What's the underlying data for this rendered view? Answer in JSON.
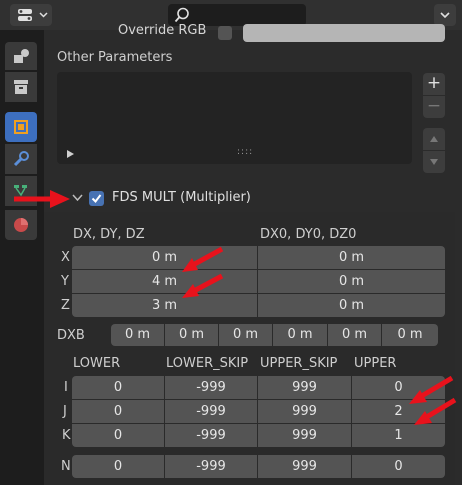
{
  "header": {
    "search_icon": "search-icon",
    "dropdown_icon": "chevron-down-icon"
  },
  "sidebar": {
    "tabs": [
      "tool-tab",
      "render-tab",
      "output-tab",
      "modifier-tab",
      "particles-tab",
      "material-tab"
    ]
  },
  "override_label": "Override RGB",
  "other_parameters": {
    "label": "Other Parameters",
    "add": "+",
    "remove": "−",
    "grip": "::::"
  },
  "fds_mult": {
    "checked": true,
    "label": "FDS MULT (Multiplier)"
  },
  "deltas": {
    "header_left": "DX, DY, DZ",
    "header_right": "DX0, DY0, DZ0",
    "rows": [
      {
        "axis": "X",
        "d": "0 m",
        "d0": "0 m"
      },
      {
        "axis": "Y",
        "d": "4 m",
        "d0": "0 m"
      },
      {
        "axis": "Z",
        "d": "3 m",
        "d0": "0 m"
      }
    ]
  },
  "dxb": {
    "label": "DXB",
    "values": [
      "0 m",
      "0 m",
      "0 m",
      "0 m",
      "0 m",
      "0 m"
    ]
  },
  "bounds": {
    "headers": [
      "LOWER",
      "LOWER_SKIP",
      "UPPER_SKIP",
      "UPPER"
    ],
    "rows": [
      {
        "axis": "I",
        "values": [
          "0",
          "-999",
          "999",
          "0"
        ]
      },
      {
        "axis": "J",
        "values": [
          "0",
          "-999",
          "999",
          "2"
        ]
      },
      {
        "axis": "K",
        "values": [
          "0",
          "-999",
          "999",
          "1"
        ]
      }
    ],
    "n_row": {
      "axis": "N",
      "values": [
        "0",
        "-999",
        "999",
        "0"
      ]
    }
  },
  "annotation_color": "#e8121c"
}
